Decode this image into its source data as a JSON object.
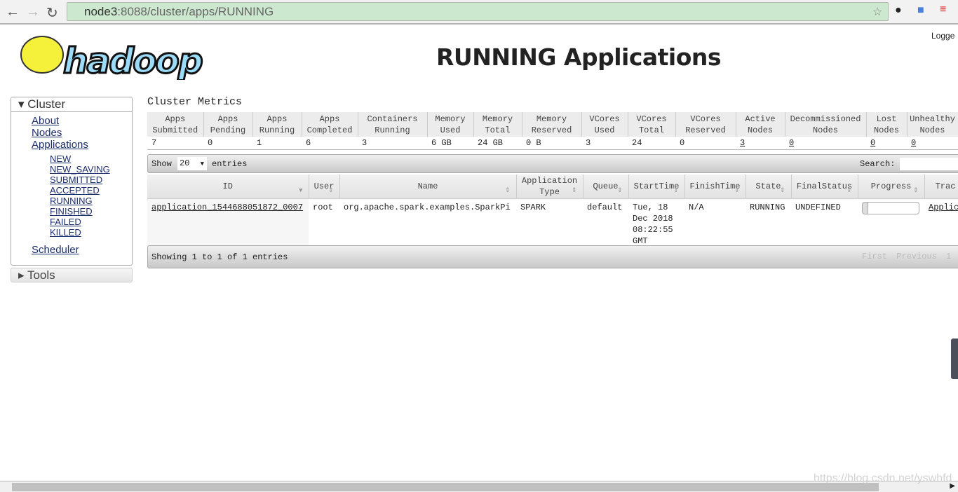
{
  "browser": {
    "url_host": "node3",
    "url_rest": ":8088/cluster/apps/RUNNING"
  },
  "header": {
    "title": "RUNNING Applications",
    "logged": "Logge",
    "logo_text": "hadoop"
  },
  "sidebar": {
    "cluster": "Cluster",
    "items": [
      "About",
      "Nodes",
      "Applications"
    ],
    "sub_items": [
      "NEW",
      "NEW_SAVING",
      "SUBMITTED",
      "ACCEPTED",
      "RUNNING",
      "FINISHED",
      "FAILED",
      "KILLED"
    ],
    "scheduler": "Scheduler",
    "tools": "Tools"
  },
  "metrics": {
    "title": "Cluster Metrics",
    "headers": [
      [
        "Apps",
        "Submitted"
      ],
      [
        "Apps",
        "Pending"
      ],
      [
        "Apps",
        "Running"
      ],
      [
        "Apps",
        "Completed"
      ],
      [
        "Containers",
        "Running"
      ],
      [
        "Memory",
        "Used"
      ],
      [
        "Memory",
        "Total"
      ],
      [
        "Memory",
        "Reserved"
      ],
      [
        "VCores",
        "Used"
      ],
      [
        "VCores",
        "Total"
      ],
      [
        "VCores",
        "Reserved"
      ],
      [
        "Active",
        "Nodes"
      ],
      [
        "Decommissioned",
        "Nodes"
      ],
      [
        "Lost",
        "Nodes"
      ],
      [
        "Unhealthy",
        "Nodes"
      ]
    ],
    "values": [
      "7",
      "0",
      "1",
      "6",
      "3",
      "6 GB",
      "24 GB",
      "0 B",
      "3",
      "24",
      "0",
      "3",
      "0",
      "0",
      "0"
    ]
  },
  "apps": {
    "show": "Show",
    "page_size": "20",
    "entries": "entries",
    "search_label": "Search:",
    "search_value": "",
    "headers": [
      [
        "ID"
      ],
      [
        "User"
      ],
      [
        "Name"
      ],
      [
        "Application",
        "Type"
      ],
      [
        "Queue"
      ],
      [
        "StartTime"
      ],
      [
        "FinishTime"
      ],
      [
        "State"
      ],
      [
        "FinalStatus"
      ],
      [
        "Progress"
      ],
      [
        "Trac"
      ]
    ],
    "rows": [
      {
        "id": "application_1544688051872_0007",
        "user": "root",
        "name": "org.apache.spark.examples.SparkPi",
        "type": "SPARK",
        "queue": "default",
        "start": [
          "Tue, 18",
          "Dec 2018",
          "08:22:55",
          "GMT"
        ],
        "finish": "N/A",
        "state": "RUNNING",
        "final": "UNDEFINED",
        "progress": 0,
        "tracking": "Applic"
      }
    ],
    "info": "Showing 1 to 1 of 1 entries",
    "pager": [
      "First",
      "Previous",
      "1"
    ]
  },
  "watermark": "https://blog.csdn.net/yswhfd"
}
